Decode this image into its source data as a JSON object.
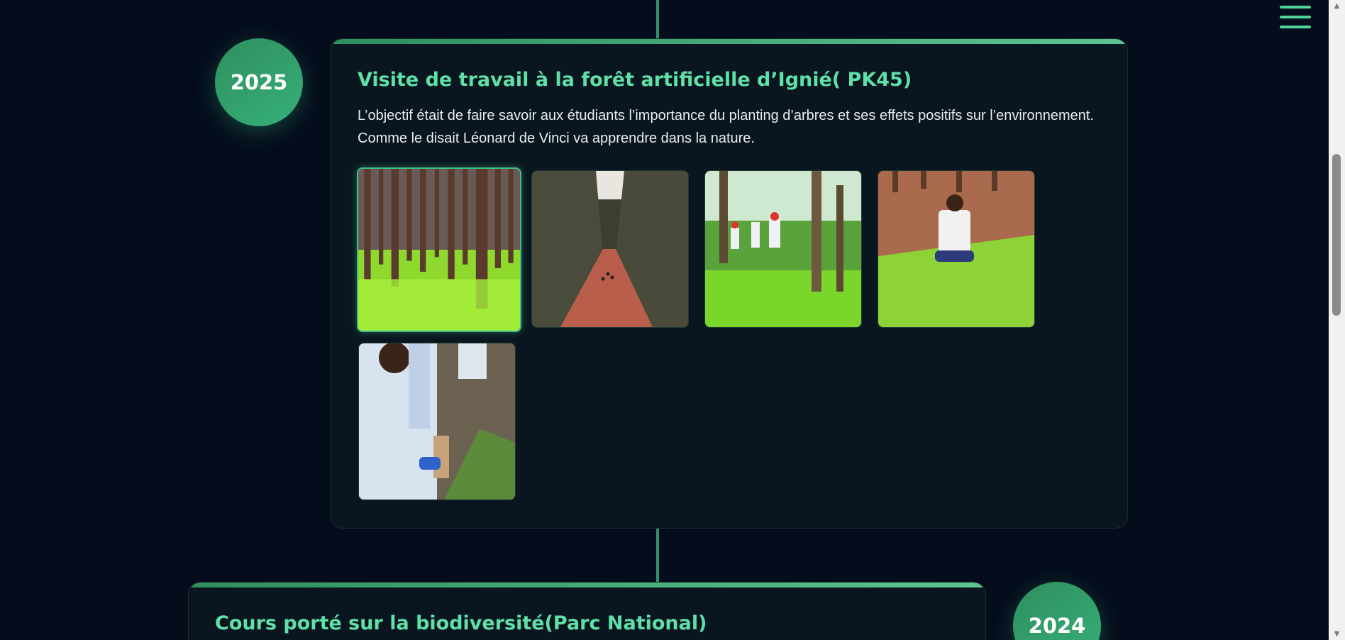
{
  "timeline": [
    {
      "year": "2025",
      "title": "Visite de travail à la forêt artificielle d’Ignié( PK45)",
      "description_lines": [
        "L’objectif était de faire savoir aux étudiants l’importance du planting d’arbres et ses effets positifs sur l’environnement.",
        "Comme le disait Léonard de Vinci va apprendre dans la nature."
      ],
      "photos": [
        {
          "name": "photo-pine-forest-grass"
        },
        {
          "name": "photo-red-dirt-road-forest"
        },
        {
          "name": "photo-students-in-forest"
        },
        {
          "name": "photo-student-crouching-grass"
        },
        {
          "name": "photo-student-holding-plant"
        }
      ]
    },
    {
      "year": "2024",
      "title": "Cours porté sur la biodiversité(Parc National)"
    }
  ],
  "icons": {
    "menu": "hamburger-menu-icon",
    "scroll_up": "scroll-up-arrow-icon",
    "scroll_down": "scroll-down-arrow-icon"
  },
  "colors": {
    "background": "#050d1c",
    "accent": "#5fe0a8",
    "bubble": "#2f9e68",
    "card": "#0a161f"
  }
}
